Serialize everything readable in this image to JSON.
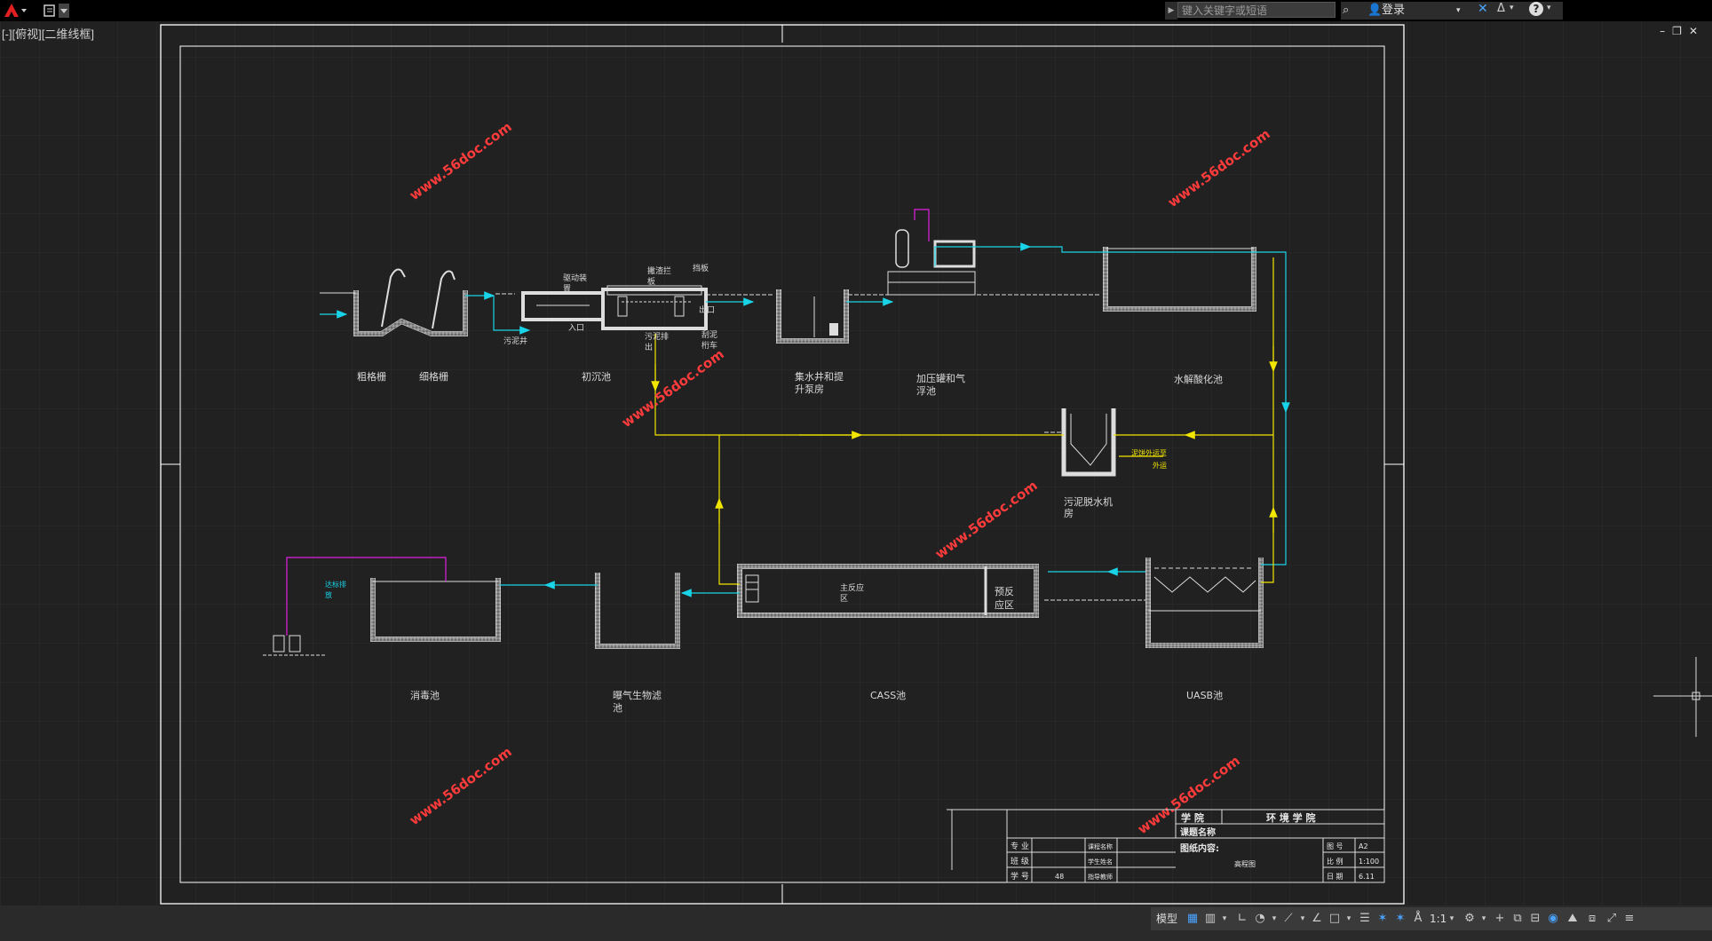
{
  "app": {
    "search_placeholder": "键入关键字或短语",
    "login_label": "登录",
    "viewport_label": "[-][俯视][二维线框]"
  },
  "drawing": {
    "labels": {
      "coarse_screen": "粗格栅",
      "fine_screen": "细格栅",
      "primary_clarifier": "初沉池",
      "sump_pump_1": "集水井和提",
      "sump_pump_2": "升泵房",
      "daf_1": "加压罐和气",
      "daf_2": "浮池",
      "hydrolysis": "水解酸化池",
      "sludge_dewater_1": "污泥脱水机",
      "sludge_dewater_2": "房",
      "disinfection": "消毒池",
      "baf_1": "曝气生物滤",
      "baf_2": "池",
      "cass": "CASS池",
      "uasb": "UASB池",
      "sewage_well": "污泥井",
      "drive_unit_1": "驱动装",
      "drive_unit_2": "置",
      "scum_1": "撇渣拦",
      "scum_2": "板",
      "baffle": "挡板",
      "outlet": "出口",
      "inlet": "入口",
      "sludge_out_1": "污泥排",
      "sludge_out_2": "出",
      "scraper_1": "刮泥",
      "scraper_2": "桁车",
      "main_reaction_1": "主反应",
      "main_reaction_2": "区",
      "pre_reaction_1": "预反",
      "pre_reaction_2": "应区",
      "sludge_outside_1": "泥饼外运至",
      "sludge_outside_2": "外运",
      "effluent_1": "达标排",
      "effluent_2": "放"
    },
    "watermark": "www.56doc.com",
    "title_block": {
      "college_label": "学 院",
      "college_value": "环 境 学 院",
      "course_label": "课题名称",
      "drawing_content_label": "图纸内容:",
      "drawing_content_value": "高程图",
      "major_label": "专 业",
      "class_label": "班 级",
      "student_no_label": "学 号",
      "student_no_value": "48",
      "course_name_label": "课程名称",
      "student_name_label": "学生姓名",
      "advisor_label": "指导教师",
      "sheet_label": "图 号",
      "sheet_value": "A2",
      "scale_label": "比 例",
      "scale_value": "1:100",
      "date_label": "日 期",
      "date_value": "6.11"
    }
  },
  "statusbar": {
    "model_label": "模型",
    "scale_label": "1:1"
  },
  "colors": {
    "background": "#212121",
    "frame": "#ffffff",
    "flow_water": "#19d4e8",
    "flow_sludge": "#f2e600",
    "watermark": "#ff3b3b",
    "gas_line": "#e020e0"
  }
}
